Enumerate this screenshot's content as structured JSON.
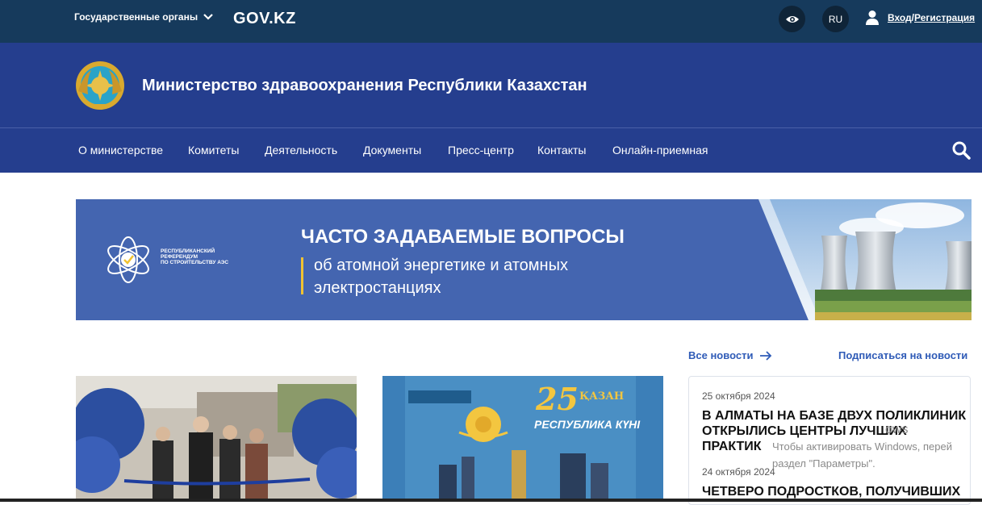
{
  "topbar": {
    "gov_bodies": "Государственные органы",
    "gov_logo": "GOV.KZ",
    "lang": "RU",
    "login": "Вход",
    "separator": "/",
    "register": "Регистрация"
  },
  "header": {
    "ministry_title": "Министерство здравоохранения Республики Казахстан"
  },
  "nav": {
    "items": [
      "О министерстве",
      "Комитеты",
      "Деятельность",
      "Документы",
      "Пресс-центр",
      "Контакты",
      "Онлайн-приемная"
    ]
  },
  "banner": {
    "ref_line1": "Республиканский",
    "ref_line2": "референдум",
    "ref_line3": "по строительству АЭС",
    "title": "ЧАСТО ЗАДАВАЕМЫЕ ВОПРОСЫ",
    "subtitle_line1": "об атомной энергетике и атомных",
    "subtitle_line2": "электростанциях"
  },
  "news": {
    "all_news": "Все новости",
    "subscribe": "Подписаться на новости",
    "card2_number": "25",
    "card2_word": "ҚАЗАН",
    "card2_caption": "РЕСПУБЛИКА КҮНІ",
    "items": [
      {
        "date": "25 октября 2024",
        "title": "В АЛМАТЫ НА БАЗЕ ДВУХ ПОЛИКЛИНИК ОТКРЫЛИСЬ ЦЕНТРЫ ЛУЧШИХ ПРАКТИК"
      },
      {
        "date": "24 октября 2024",
        "title": "ЧЕТВЕРО ПОДРОСТКОВ, ПОЛУЧИВШИХ"
      }
    ]
  },
  "watermark": {
    "line1": "ows",
    "line2": "Чтобы активировать Windows, перей",
    "line3": "раздел \"Параметры\"."
  },
  "colors": {
    "topbar": "#163a5c",
    "header": "#253e8e",
    "banner": "#4465b0",
    "accent_link": "#2f5bb7",
    "banner_bar": "#f1c232"
  }
}
